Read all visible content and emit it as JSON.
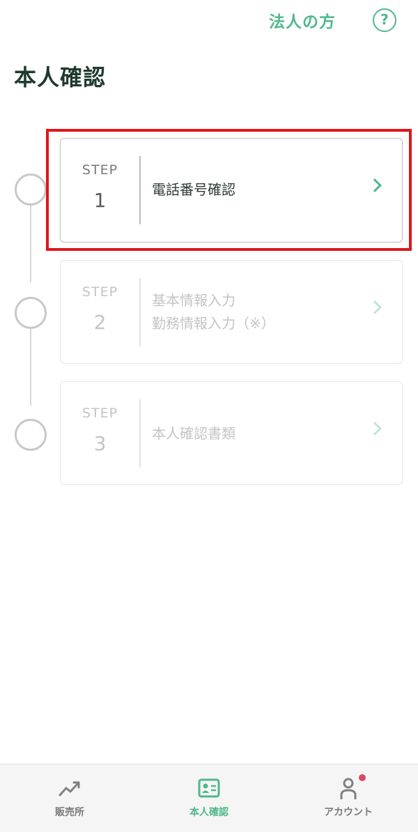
{
  "header": {
    "corp_link": "法人の方",
    "help_label": "?"
  },
  "page_title": "本人確認",
  "steps": [
    {
      "label": "STEP",
      "number": "1",
      "lines": [
        "電話番号確認"
      ],
      "active": true
    },
    {
      "label": "STEP",
      "number": "2",
      "lines": [
        "基本情報入力",
        "勤務情報入力（※）"
      ],
      "active": false
    },
    {
      "label": "STEP",
      "number": "3",
      "lines": [
        "本人確認書類"
      ],
      "active": false
    }
  ],
  "tabs": [
    {
      "label": "販売所",
      "icon": "trend-up-icon"
    },
    {
      "label": "本人確認",
      "icon": "id-card-icon",
      "active": true
    },
    {
      "label": "アカウント",
      "icon": "user-icon",
      "badge": true
    }
  ],
  "colors": {
    "accent": "#4fb88b",
    "highlight": "#e0151b",
    "badge": "#e0466a"
  }
}
